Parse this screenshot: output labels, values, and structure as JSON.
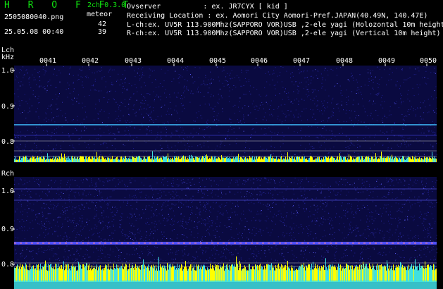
{
  "header": {
    "app_title": "H R O F F T",
    "version": "2ch 0.3.0",
    "file_name": "2505080040.png",
    "meteor_label": "meteor",
    "count_l": "42",
    "count_r": "39",
    "datetime": "25.05.08 00:40",
    "observer": "Ovserver          : ex. JR7CYX [ kid ]",
    "location": "Receiving Location : ex. Aomori City Aomori-Pref.JAPAN(40.49N, 140.47E)",
    "lch_info": "L-ch:ex. UV5R 113.900Mhz(SAPPORO VOR)USB ,2-ele yagi (Holozontal 10m height)",
    "rch_info": "R-ch:ex. UV5R 113.900Mhz(SAPPORO VOR)USB ,2-ele yagi (Vertical 10m height)"
  },
  "time_axis": {
    "ticks": [
      "0041",
      "0042",
      "0043",
      "0044",
      "0045",
      "0046",
      "0047",
      "0048",
      "0049",
      "0050"
    ]
  },
  "lch_panel": {
    "label": "Lch",
    "unit": "kHz",
    "freq_labels": [
      "1.0",
      "0.9",
      "0.8"
    ]
  },
  "rch_panel": {
    "label": "Rch",
    "freq_labels": [
      "1.0",
      "0.9",
      "0.8"
    ]
  },
  "colors": {
    "text_green": "#10e010",
    "text_white": "#ffffff",
    "spectrum_bg": "#0a0a40",
    "carrier": "#40c0ff",
    "level_yellow": "#ffff00",
    "level_cyan": "#40e0e0"
  }
}
